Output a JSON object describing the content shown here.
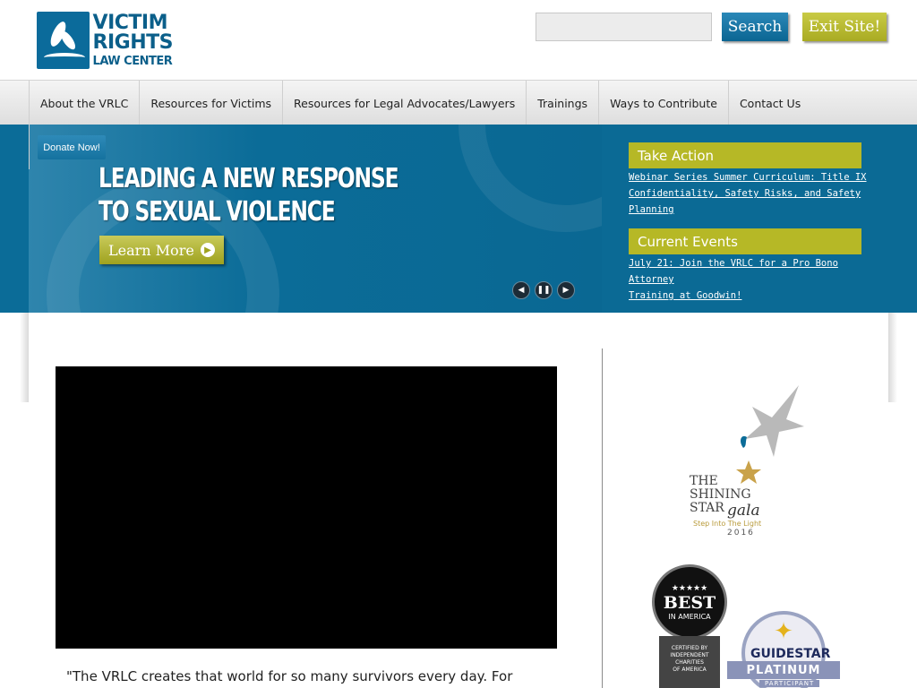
{
  "header": {
    "logo": {
      "line1": "VICTIM",
      "line2": "RIGHTS",
      "line3": "LAW CENTER"
    },
    "search": {
      "value": "",
      "placeholder": "",
      "button_label": "Search"
    },
    "exit_label": "Exit Site!"
  },
  "nav": {
    "items": [
      {
        "label": "About the VRLC"
      },
      {
        "label": "Resources for Victims"
      },
      {
        "label": "Resources for Legal Advocates/Lawyers"
      },
      {
        "label": "Trainings"
      },
      {
        "label": "Ways to Contribute"
      },
      {
        "label": "Contact Us"
      }
    ],
    "donate_label": "Donate Now!"
  },
  "hero": {
    "headline_line1": "LEADING A NEW RESPONSE",
    "headline_line2": "TO SEXUAL VIOLENCE",
    "learn_more_label": "Learn More",
    "slider_icons": {
      "prev": "prev-icon",
      "pause": "pause-icon",
      "next": "next-icon"
    }
  },
  "sidebar_panels": {
    "take_action": {
      "title": "Take Action",
      "link_line1": "Webinar Series Summer Curriculum: Title IX",
      "link_line2": "Confidentiality, Safety Risks, and Safety",
      "link_line3": "Planning"
    },
    "current_events": {
      "title": "Current Events",
      "link_line1": "July 21: Join the VRLC for a Pro Bono Attorney",
      "link_line2": "Training at Goodwin!"
    }
  },
  "main": {
    "quote": "\"The VRLC creates that world for so many survivors every day. For"
  },
  "sidebar": {
    "gala": {
      "line1": "THE",
      "line2": "SHINING",
      "line3": "STAR",
      "script": "gala",
      "tagline": "Step Into The Light",
      "year": "2016"
    },
    "best_badge": {
      "stars": "★★★★★",
      "best": "BEST",
      "in_america": "IN AMERICA",
      "ribbon1": "CERTIFIED BY",
      "ribbon2": "INDEPENDENT",
      "ribbon3": "CHARITIES",
      "ribbon4": "OF AMERICA"
    },
    "guidestar": {
      "name": "GUIDESTAR",
      "level": "PLATINUM",
      "participant": "PARTICIPANT"
    }
  },
  "colors": {
    "brand_blue": "#0b6c98",
    "accent_olive": "#b6b826",
    "nav_bg": "#e8e8e8"
  }
}
